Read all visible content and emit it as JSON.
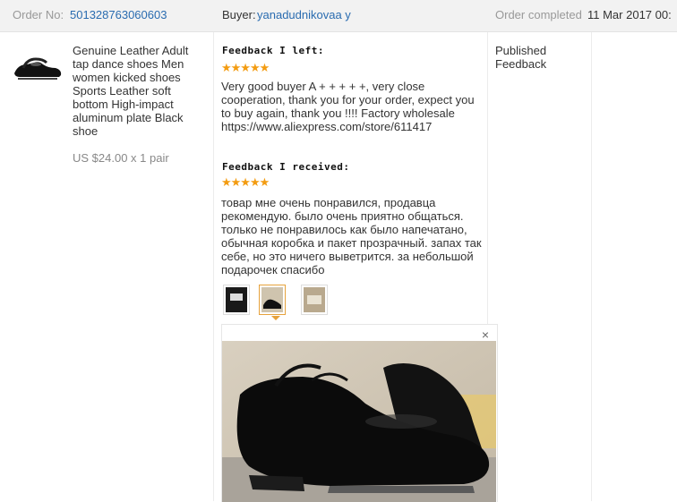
{
  "header": {
    "order_no_label": "Order No:",
    "order_no": "501328763060603",
    "buyer_label": "Buyer:",
    "buyer_name": "yanadudnikovaa y",
    "status_label": "Order completed",
    "date": "11 Mar 2017 00:"
  },
  "product": {
    "title": "Genuine Leather Adult tap dance shoes Men women kicked shoes Sports Leather soft bottom High-impact aluminum plate Black shoe",
    "price": "US $24.00 x 1 pair"
  },
  "feedback_left": {
    "label": "Feedback I left:",
    "rating": 5,
    "stars": "★★★★★",
    "text": "Very good buyer A + + + + +, very close cooperation, thank you for your order, expect you to buy again, thank you !!!! Factory wholesale https://www.aliexpress.com/store/611417"
  },
  "feedback_received": {
    "label": "Feedback I received:",
    "rating": 5,
    "stars": "★★★★★",
    "text": "товар мне очень понравился, продавца рекомендую. было очень приятно общаться. только не понравилось как было напечатано, обычная коробка и пакет прозрачный. запах так себе, но это ничего выветрится. за небольшой подарочек спасибо"
  },
  "status": {
    "line1": "Published",
    "line2": "Feedback"
  },
  "viewer": {
    "close": "×"
  },
  "colors": {
    "accent": "#e6a23c",
    "link": "#2a6cb0",
    "star": "#f39c12"
  },
  "icons": {
    "close": "close-icon",
    "stars": "star-icon"
  }
}
